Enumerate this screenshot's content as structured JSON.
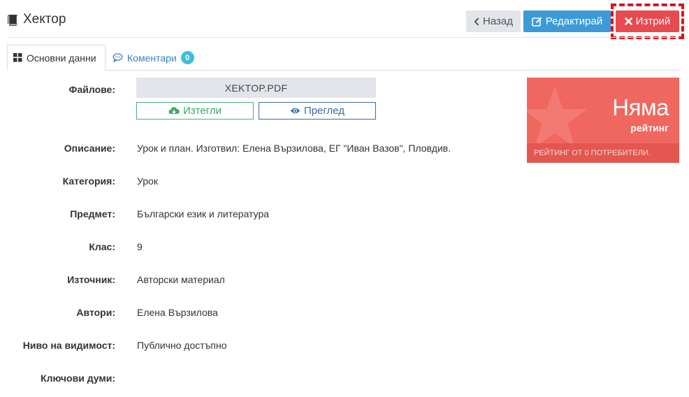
{
  "header": {
    "title": "Хектор",
    "icon": "book-icon",
    "buttons": {
      "back": "Назад",
      "edit": "Редактирай",
      "delete": "Изтрий"
    }
  },
  "tabs": {
    "basic": "Основни данни",
    "comments": "Коментари",
    "comments_count": "0"
  },
  "files": {
    "label": "Файлове:",
    "file_name": "XEKTOP.PDF",
    "download": "Изтегли",
    "preview": "Преглед"
  },
  "fields": [
    {
      "label": "Описание:",
      "value": "Урок и план. Изготвил: Елена Вързилова, ЕГ \"Иван Вазов\", Пловдив."
    },
    {
      "label": "Категория:",
      "value": "Урок"
    },
    {
      "label": "Предмет:",
      "value": "Български език и литература"
    },
    {
      "label": "Клас:",
      "value": "9"
    },
    {
      "label": "Източник:",
      "value": "Авторски материал"
    },
    {
      "label": "Автори:",
      "value": "Елена Вързилова"
    },
    {
      "label": "Ниво на видимост:",
      "value": "Публично достъпно"
    },
    {
      "label": "Ключови думи:",
      "value": ""
    }
  ],
  "rating": {
    "big": "Няма",
    "small": "рейтинг",
    "footer": "РЕЙТИНГ ОТ 0 ПОТРЕБИТЕЛИ."
  },
  "colors": {
    "back": "#e3e5ea",
    "edit": "#3c9ad8",
    "delete": "#e84a4f",
    "highlight": "#e0101a",
    "rating": "#f0675f",
    "badge": "#3dc0d9"
  }
}
